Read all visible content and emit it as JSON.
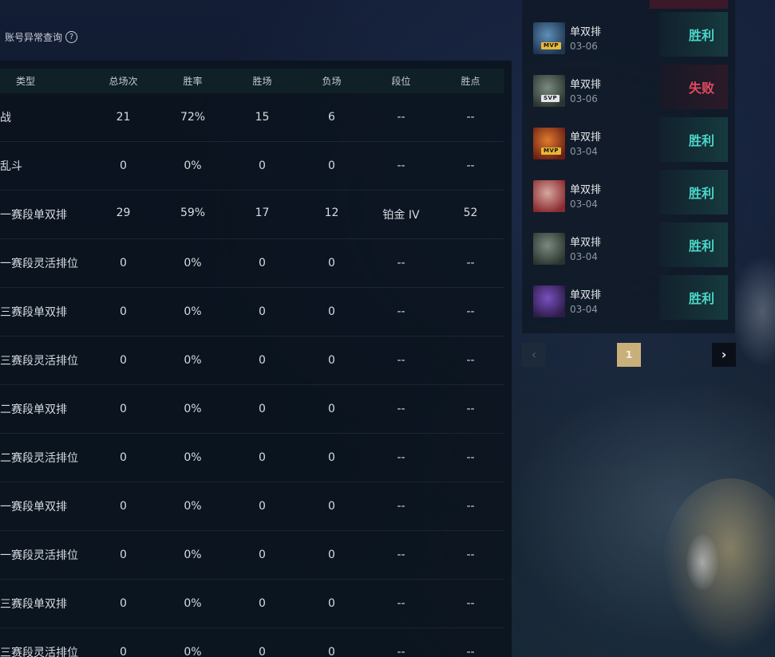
{
  "header": {
    "abnormal_query_label": "账号异常查询",
    "help_icon_glyph": "?"
  },
  "stats_table": {
    "columns": [
      "类型",
      "总场次",
      "胜率",
      "胜场",
      "负场",
      "段位",
      "胜点"
    ],
    "rows": [
      {
        "type": "战",
        "total": "21",
        "winrate": "72%",
        "wins": "15",
        "losses": "6",
        "rank": "--",
        "lp": "--"
      },
      {
        "type": "乱斗",
        "total": "0",
        "winrate": "0%",
        "wins": "0",
        "losses": "0",
        "rank": "--",
        "lp": "--"
      },
      {
        "type": "一赛段单双排",
        "total": "29",
        "winrate": "59%",
        "wins": "17",
        "losses": "12",
        "rank": "铂金 IV",
        "lp": "52"
      },
      {
        "type": "一赛段灵活排位",
        "total": "0",
        "winrate": "0%",
        "wins": "0",
        "losses": "0",
        "rank": "--",
        "lp": "--"
      },
      {
        "type": "三赛段单双排",
        "total": "0",
        "winrate": "0%",
        "wins": "0",
        "losses": "0",
        "rank": "--",
        "lp": "--"
      },
      {
        "type": "三赛段灵活排位",
        "total": "0",
        "winrate": "0%",
        "wins": "0",
        "losses": "0",
        "rank": "--",
        "lp": "--"
      },
      {
        "type": "二赛段单双排",
        "total": "0",
        "winrate": "0%",
        "wins": "0",
        "losses": "0",
        "rank": "--",
        "lp": "--"
      },
      {
        "type": "二赛段灵活排位",
        "total": "0",
        "winrate": "0%",
        "wins": "0",
        "losses": "0",
        "rank": "--",
        "lp": "--"
      },
      {
        "type": "一赛段单双排",
        "total": "0",
        "winrate": "0%",
        "wins": "0",
        "losses": "0",
        "rank": "--",
        "lp": "--"
      },
      {
        "type": "一赛段灵活排位",
        "total": "0",
        "winrate": "0%",
        "wins": "0",
        "losses": "0",
        "rank": "--",
        "lp": "--"
      },
      {
        "type": "三赛段单双排",
        "total": "0",
        "winrate": "0%",
        "wins": "0",
        "losses": "0",
        "rank": "--",
        "lp": "--"
      },
      {
        "type": "三赛段灵活排位",
        "total": "0",
        "winrate": "0%",
        "wins": "0",
        "losses": "0",
        "rank": "--",
        "lp": "--"
      }
    ]
  },
  "match_history": {
    "items": [
      {
        "mode": "单双排",
        "date": "03-06",
        "badge": "MVP",
        "result": "胜利",
        "outcome": "win",
        "avatar_colors": [
          "#5f8fb8",
          "#1f3550"
        ]
      },
      {
        "mode": "单双排",
        "date": "03-06",
        "badge": "SVP",
        "result": "失败",
        "outcome": "lose",
        "avatar_colors": [
          "#7a8a7e",
          "#2b3530"
        ]
      },
      {
        "mode": "单双排",
        "date": "03-04",
        "badge": "MVP",
        "result": "胜利",
        "outcome": "win",
        "avatar_colors": [
          "#e07a2e",
          "#6b1f14"
        ]
      },
      {
        "mode": "单双排",
        "date": "03-04",
        "badge": "",
        "result": "胜利",
        "outcome": "win",
        "avatar_colors": [
          "#d6a8a0",
          "#8a2a2e"
        ]
      },
      {
        "mode": "单双排",
        "date": "03-04",
        "badge": "",
        "result": "胜利",
        "outcome": "win",
        "avatar_colors": [
          "#7a8a7e",
          "#2b3530"
        ]
      },
      {
        "mode": "单双排",
        "date": "03-04",
        "badge": "",
        "result": "胜利",
        "outcome": "win",
        "avatar_colors": [
          "#7a4fc0",
          "#2c1c48"
        ]
      }
    ]
  },
  "pagination": {
    "prev_glyph": "‹",
    "current_page": "1",
    "next_glyph": "›"
  }
}
